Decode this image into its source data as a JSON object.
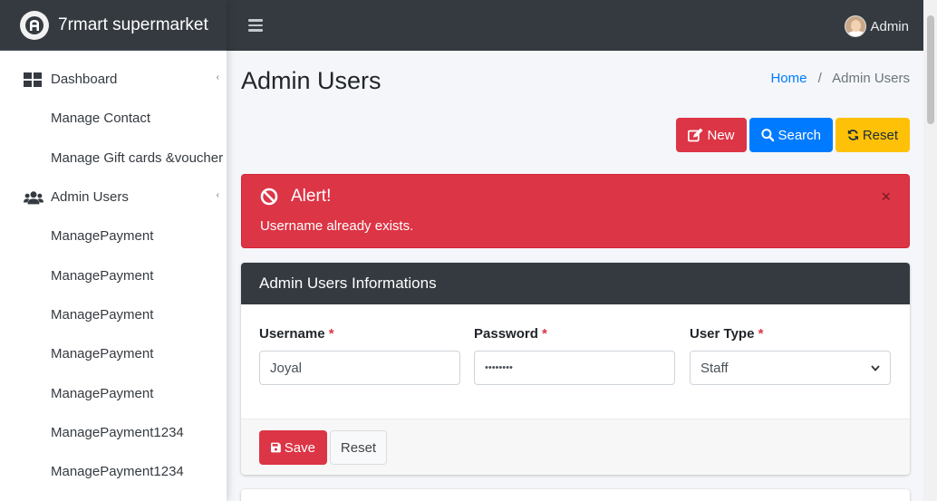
{
  "brand": {
    "title": "7rmart supermarket",
    "logo_icon": "brand-logo-icon"
  },
  "sidebar": {
    "items": [
      {
        "label": "Dashboard",
        "icon": "grid-icon",
        "caret": "‹"
      },
      {
        "label": "Manage Contact"
      },
      {
        "label": "Manage Gift cards &voucher"
      },
      {
        "label": "Admin Users",
        "icon": "users-icon",
        "caret": "‹"
      },
      {
        "label": "ManagePayment"
      },
      {
        "label": "ManagePayment"
      },
      {
        "label": "ManagePayment"
      },
      {
        "label": "ManagePayment"
      },
      {
        "label": "ManagePayment"
      },
      {
        "label": "ManagePayment1234"
      },
      {
        "label": "ManagePayment1234"
      }
    ]
  },
  "topbar": {
    "user_name": "Admin"
  },
  "page": {
    "title": "Admin Users"
  },
  "breadcrumb": {
    "home": "Home",
    "separator": "/",
    "current": "Admin Users"
  },
  "actions": {
    "new_label": "New",
    "search_label": "Search",
    "reset_label": "Reset"
  },
  "alert": {
    "title": "Alert!",
    "message": "Username already exists.",
    "close": "×"
  },
  "form": {
    "header": "Admin Users Informations",
    "username_label": "Username",
    "password_label": "Password",
    "usertype_label": "User Type",
    "required_mark": "*",
    "username_value": "Joyal",
    "password_value": "••••••••",
    "usertype_value": "Staff",
    "save_label": "Save",
    "reset_label": "Reset"
  },
  "colors": {
    "danger": "#dc3545",
    "primary": "#007bff",
    "warning": "#ffc107",
    "dark": "#343a40"
  }
}
